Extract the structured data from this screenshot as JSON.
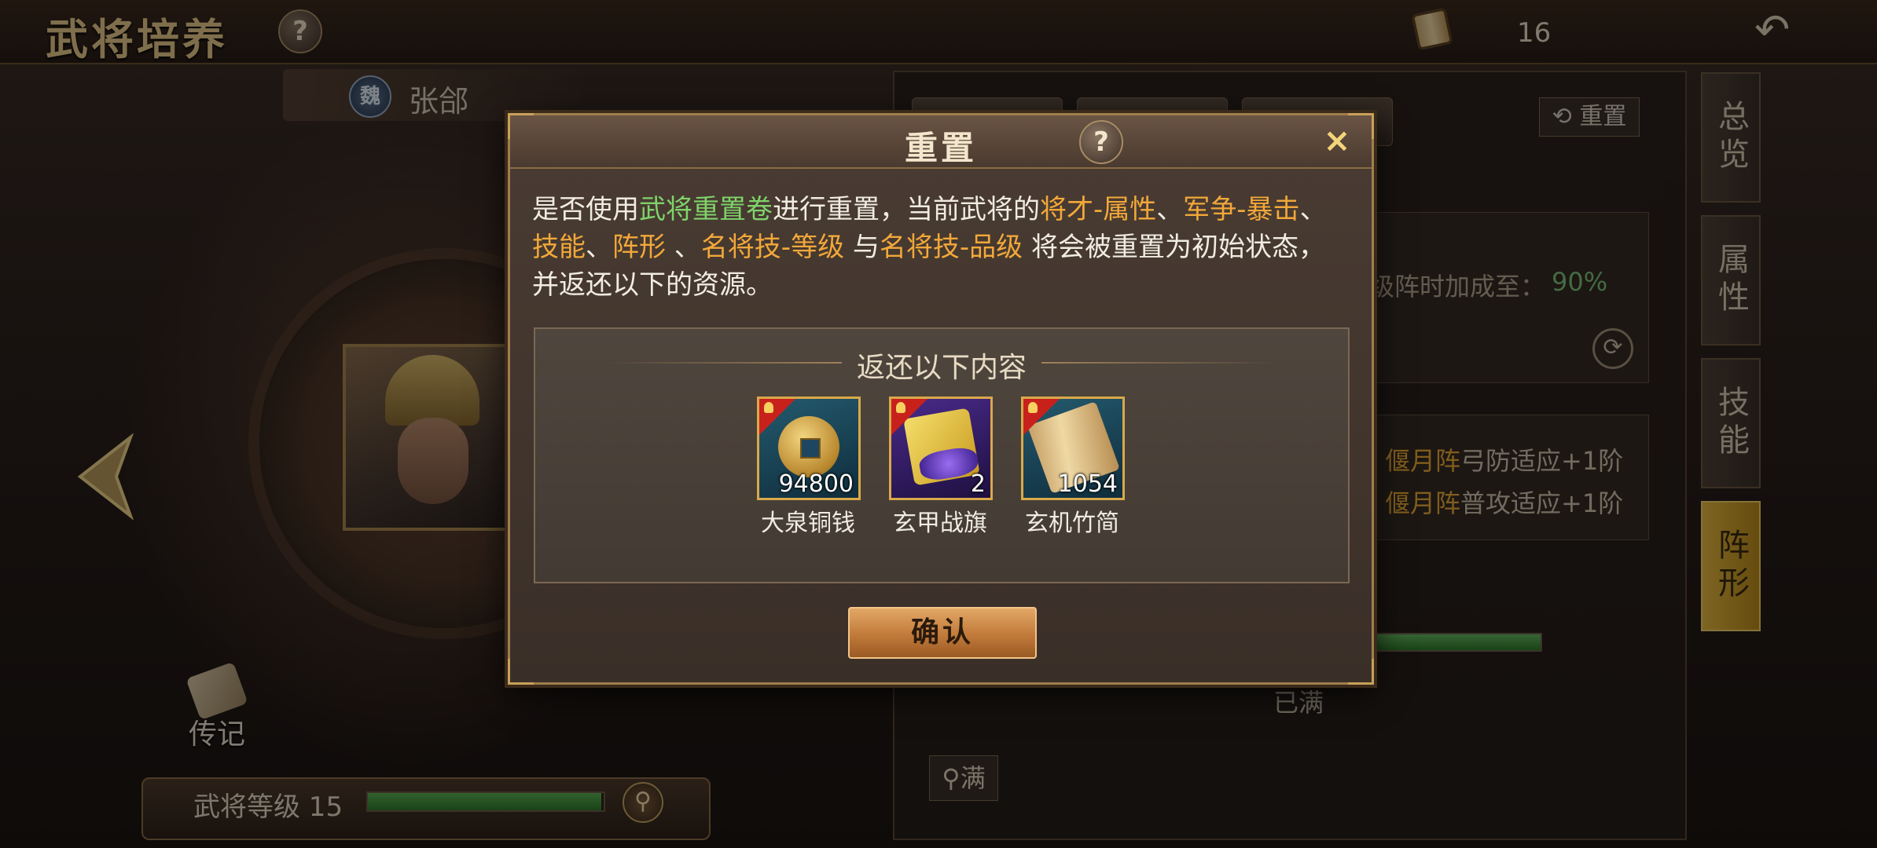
{
  "header": {
    "title": "武将培养",
    "help": "?",
    "scroll_count": "16",
    "back_icon": "back-arrow-icon"
  },
  "hero": {
    "faction": "魏",
    "name": "张郃",
    "bio_label": "传记",
    "level_label": "武将等级 15",
    "level_progress": 0.99
  },
  "right_panel": {
    "reset_label": "重置",
    "partial_text": "级阵时加成至：",
    "partial_pct": "90%",
    "formation_lines": [
      {
        "name": "偃月阵",
        "effect": "弓防适应+1阶"
      },
      {
        "name": "偃月阵",
        "effect": "普攻适应+1阶"
      }
    ],
    "bar_progress": 1.0,
    "full_text": "已满",
    "max_label": "满"
  },
  "side_tabs": [
    {
      "label": "总览",
      "active": false
    },
    {
      "label": "属性",
      "active": false
    },
    {
      "label": "技能",
      "active": false
    },
    {
      "label": "阵形",
      "active": true
    }
  ],
  "modal": {
    "title": "重置",
    "help": "?",
    "close": "×",
    "message": {
      "p1": "是否使用",
      "item": "武将重置卷",
      "p2": "进行重置，当前武将的",
      "k1": "将才-属性",
      "s1": "、",
      "k2": "军争-暴击",
      "s2": "、",
      "k3": "技能",
      "s3": "、",
      "k4": "阵形",
      "s4": " 、",
      "k5": "名将技-等级",
      "s5": " 与",
      "k6": "名将技-品级",
      "p3": " 将会被重置为初始状态，并返还以下的资源。"
    },
    "reward_title": "返还以下内容",
    "items": [
      {
        "name": "大泉铜钱",
        "count": "94800",
        "icon": "copper-coin-icon"
      },
      {
        "name": "玄甲战旗",
        "count": "2",
        "icon": "war-banner-icon"
      },
      {
        "name": "玄机竹简",
        "count": "1054",
        "icon": "bamboo-scroll-icon"
      }
    ],
    "confirm_label": "确认"
  },
  "colors": {
    "green": "#7fd36a",
    "orange": "#f2a83a",
    "gold_border": "#d9a94a",
    "active_tab": "#e5b840"
  }
}
